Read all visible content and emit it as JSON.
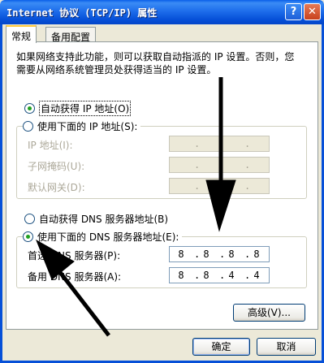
{
  "window": {
    "title": "Internet 协议 (TCP/IP) 属性",
    "help_glyph": "?",
    "close_glyph": "✕"
  },
  "tabs": [
    {
      "label": "常规",
      "active": true
    },
    {
      "label": "备用配置",
      "active": false
    }
  ],
  "description": "如果网络支持此功能，则可以获取自动指派的 IP 设置。否则，您需要从网络系统管理员处获得适当的 IP 设置。",
  "ip": {
    "auto_label": "自动获得 IP 地址(O)",
    "manual_label": "使用下面的 IP 地址(S):",
    "auto_selected": true,
    "fields": [
      {
        "label": "IP 地址(I):",
        "value": [
          "",
          "",
          "",
          ""
        ]
      },
      {
        "label": "子网掩码(U):",
        "value": [
          "",
          "",
          "",
          ""
        ]
      },
      {
        "label": "默认网关(D):",
        "value": [
          "",
          "",
          "",
          ""
        ]
      }
    ]
  },
  "dns": {
    "auto_label": "自动获得 DNS 服务器地址(B)",
    "manual_label": "使用下面的 DNS 服务器地址(E):",
    "manual_selected": true,
    "preferred_label": "首选 DNS 服务器(P):",
    "alternate_label": "备用 DNS 服务器(A):",
    "preferred_value": [
      "8",
      "8",
      "8",
      "8"
    ],
    "alternate_value": [
      "8",
      "8",
      "4",
      "4"
    ]
  },
  "buttons": {
    "advanced": "高级(V)...",
    "ok": "确定",
    "cancel": "取消"
  },
  "annotation_color": "#000000"
}
